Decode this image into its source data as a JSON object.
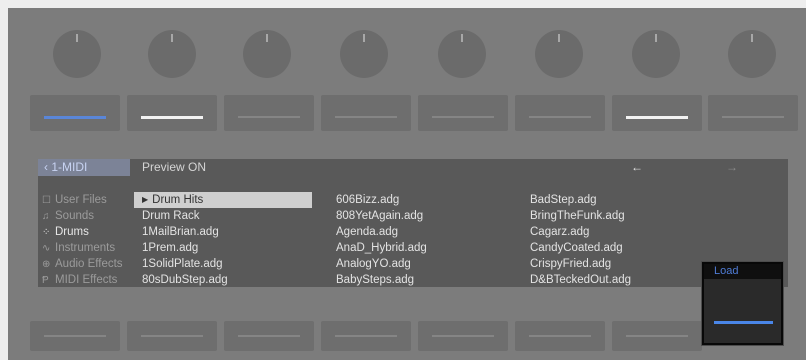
{
  "header": {
    "back_label": "‹ 1-MIDI",
    "preview_label": "Preview ON",
    "prev_arrow": "←",
    "next_arrow": "→"
  },
  "sidebar": {
    "items": [
      {
        "icon": "☐",
        "icon_name": "monitor-icon",
        "label": "User Files",
        "active": false
      },
      {
        "icon": "♫",
        "icon_name": "music-note-icon",
        "label": "Sounds",
        "active": false
      },
      {
        "icon": "⁘",
        "icon_name": "grid-icon",
        "label": "Drums",
        "active": true
      },
      {
        "icon": "∿",
        "icon_name": "wave-icon",
        "label": "Instruments",
        "active": false
      },
      {
        "icon": "⊕",
        "icon_name": "audio-effect-icon",
        "label": "Audio Effects",
        "active": false
      },
      {
        "icon": "Ᵽ",
        "icon_name": "midi-effect-icon",
        "label": "MIDI Effects",
        "active": false
      }
    ]
  },
  "browser": {
    "column1": [
      {
        "label": "Drum Hits",
        "folder": true,
        "selected": true
      },
      {
        "label": "Drum Rack"
      },
      {
        "label": "1MailBrian.adg"
      },
      {
        "label": "1Prem.adg"
      },
      {
        "label": "1SolidPlate.adg"
      },
      {
        "label": "80sDubStep.adg"
      }
    ],
    "column2": [
      "606Bizz.adg",
      "808YetAgain.adg",
      "Agenda.adg",
      "AnaD_Hybrid.adg",
      "AnalogYO.adg",
      "BabySteps.adg"
    ],
    "column3": [
      "BadStep.adg",
      "BringTheFunk.adg",
      "Cagarz.adg",
      "CandyCoated.adg",
      "CrispyFried.adg",
      "D&BTeckedOut.adg"
    ]
  },
  "top_buttons": [
    "blue",
    "white",
    "off",
    "off",
    "off",
    "off",
    "white",
    "off"
  ],
  "load": {
    "label": "Load"
  },
  "colors": {
    "accent_blue": "#4a86e8",
    "selection": "#cfcfcf",
    "display_bg": "#595959"
  }
}
